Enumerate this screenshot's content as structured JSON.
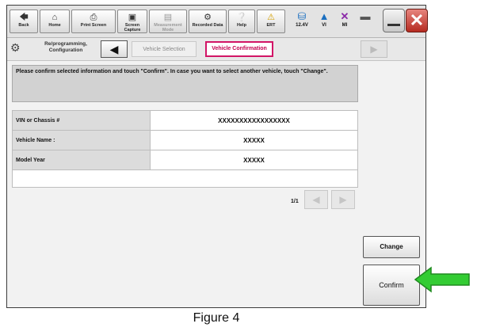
{
  "toolbar": {
    "back": "Back",
    "home": "Home",
    "print_screen": "Print Screen",
    "screen_capture": "Screen Capture",
    "measurement_mode": "Measurement Mode",
    "recorded_data": "Recorded Data",
    "help": "Help",
    "ert": "ERT",
    "battery": "12.4V",
    "vi": "VI",
    "mi": "MI"
  },
  "nav": {
    "section_label": "Re/programming, Configuration",
    "crumb_vehicle_selection": "Vehicle Selection",
    "crumb_vehicle_confirmation": "Vehicle Confirmation"
  },
  "message": "Please confirm selected information and touch \"Confirm\". In case you want to select another vehicle, touch \"Change\".",
  "info_rows": [
    {
      "label": "VIN or Chassis #",
      "value": "XXXXXXXXXXXXXXXXX"
    },
    {
      "label": "Vehicle Name :",
      "value": "XXXXX"
    },
    {
      "label": "Model Year",
      "value": "XXXXX"
    }
  ],
  "pagination": "1/1",
  "buttons": {
    "change": "Change",
    "confirm": "Confirm"
  },
  "caption": "Figure 4",
  "colors": {
    "active_crumb": "#d21566",
    "close_button": "#c0392b",
    "arrow": "#33cc33"
  }
}
